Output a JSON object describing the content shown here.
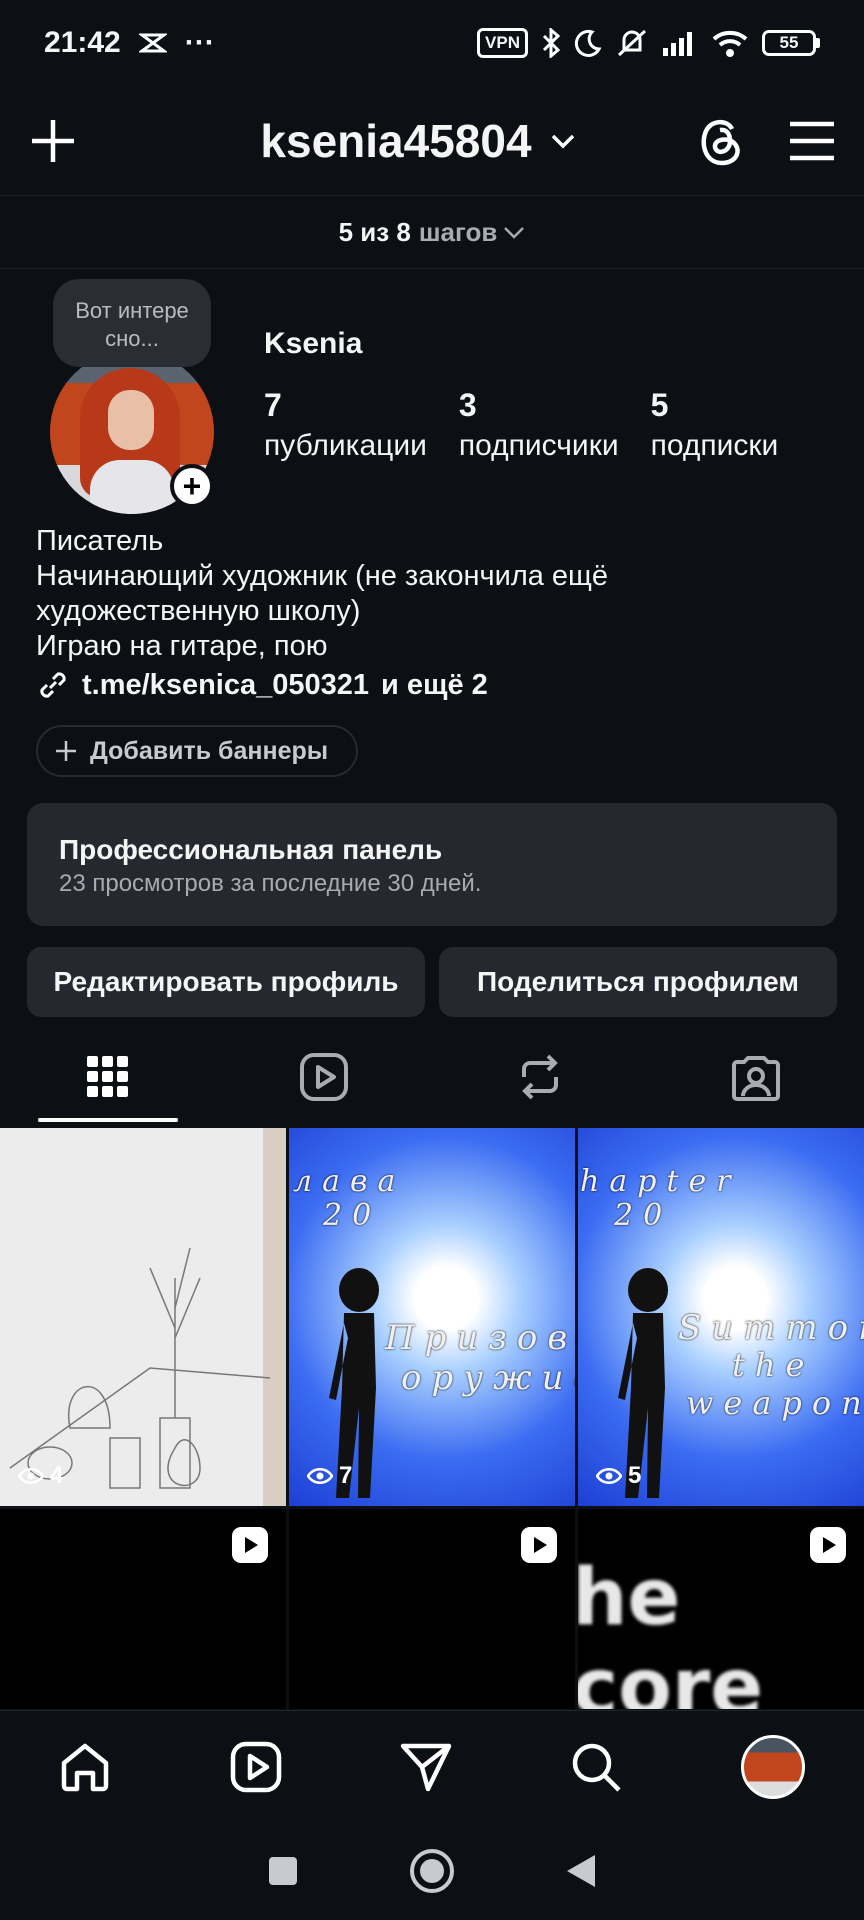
{
  "status_bar": {
    "time": "21:42",
    "more": "···",
    "vpn": "VPN",
    "battery": "55",
    "icons": [
      "notification-icon",
      "bluetooth-icon",
      "moon-icon",
      "mute-icon",
      "signal-icon",
      "wifi-icon",
      "battery-icon"
    ]
  },
  "header": {
    "username": "ksenia45804",
    "icons": [
      "plus-icon",
      "chevron-down-icon",
      "threads-icon",
      "menu-icon"
    ]
  },
  "steps": {
    "count": "5 из 8",
    "label": "шагов"
  },
  "profile": {
    "note": "Вот интере сно...",
    "display_name": "Ksenia",
    "stats": [
      {
        "value": "7",
        "label": "публикации"
      },
      {
        "value": "3",
        "label": "подписчики"
      },
      {
        "value": "5",
        "label": "подписки"
      }
    ],
    "bio": [
      "Писатель",
      "Начинающий художник (не закончила ещё художественную школу)",
      "Играю на гитаре, пою"
    ],
    "link": "t.me/ksenica_050321",
    "link_more": "и ещё 2",
    "add_banners": "Добавить баннеры"
  },
  "pro_panel": {
    "title": "Профессиональная панель",
    "subtitle": "23 просмотров за последние 30 дней."
  },
  "actions": {
    "edit": "Редактировать профиль",
    "share": "Поделиться профилем"
  },
  "tabs": [
    "grid-icon",
    "reels-icon",
    "reposts-icon",
    "tagged-icon"
  ],
  "grid": [
    {
      "type": "sketch",
      "views": "4"
    },
    {
      "type": "blue",
      "views": "7",
      "line1": "лава",
      "line2": "20",
      "line3": "Призов",
      "line4": "оружие"
    },
    {
      "type": "blue",
      "views": "5",
      "line1": "hapter",
      "line2": "20",
      "line3": "Summon",
      "line4": "the",
      "line5": "weapon"
    },
    {
      "type": "black"
    },
    {
      "type": "black"
    },
    {
      "type": "black",
      "text": "he core"
    }
  ],
  "bottom_nav": [
    "home-icon",
    "reels-icon",
    "send-icon",
    "search-icon",
    "profile-avatar"
  ],
  "system_nav": [
    "recents-button",
    "home-button",
    "back-button"
  ]
}
